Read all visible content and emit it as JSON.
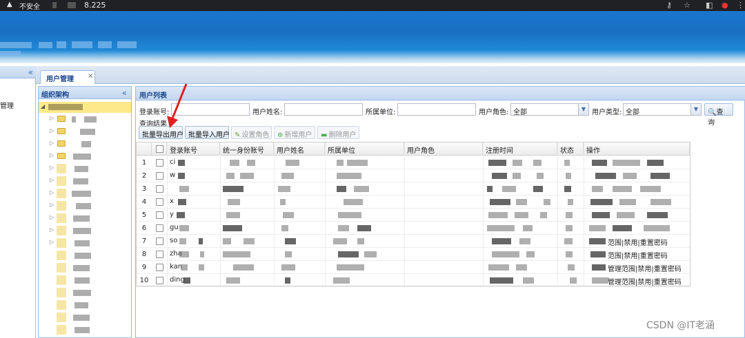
{
  "browser": {
    "insecure_label": "不安全",
    "url_suffix": "8.225"
  },
  "nav": {
    "collapse_icon": "«",
    "management_label": "管理"
  },
  "tabs": [
    {
      "label": "用户管理",
      "close": "×"
    }
  ],
  "org_panel": {
    "title": "组织架构",
    "collapse_icon": "«"
  },
  "user_panel": {
    "title": "用户列表",
    "filters": {
      "account_label": "登录账号:",
      "account_value": "",
      "name_label": "用户姓名:",
      "name_value": "",
      "unit_label": "所属单位:",
      "unit_value": "",
      "role_label": "用户角色:",
      "role_value": "全部",
      "type_label": "用户类型:",
      "type_value": "全部",
      "query_button": "查询"
    },
    "results_label": "查询结果",
    "toolbar": {
      "batch_export": "批量导出用户",
      "batch_import": "批量导入用户",
      "set_role": "设置角色",
      "add_user": "新增用户",
      "delete_user": "删除用户"
    },
    "columns": [
      "登录账号",
      "统一身份账号",
      "用户姓名",
      "所属单位",
      "用户角色",
      "注册时间",
      "状态",
      "操作"
    ],
    "rows": [
      {
        "num": "1",
        "account": "ci",
        "ops": ""
      },
      {
        "num": "2",
        "account": "w",
        "ops": ""
      },
      {
        "num": "3",
        "account": "",
        "ops": ""
      },
      {
        "num": "4",
        "account": "x",
        "ops": ""
      },
      {
        "num": "5",
        "account": "y",
        "ops": ""
      },
      {
        "num": "6",
        "account": "gu",
        "ops": ""
      },
      {
        "num": "7",
        "account": "so",
        "ops": "范围|禁用|重置密码"
      },
      {
        "num": "8",
        "account": "zha",
        "ops": "范围|禁用|重置密码"
      },
      {
        "num": "9",
        "account": "kan",
        "ops": "管理范围|禁用|重置密码"
      },
      {
        "num": "10",
        "account": "ding",
        "ops": "管理范围|禁用|重置密码"
      }
    ]
  },
  "watermark": "CSDN @IT老涵",
  "colors": {
    "banner": "#1a6fc2",
    "panel_header": "#c3d7ef",
    "panel_title": "#15428b",
    "annotation_arrow": "#e02020"
  }
}
